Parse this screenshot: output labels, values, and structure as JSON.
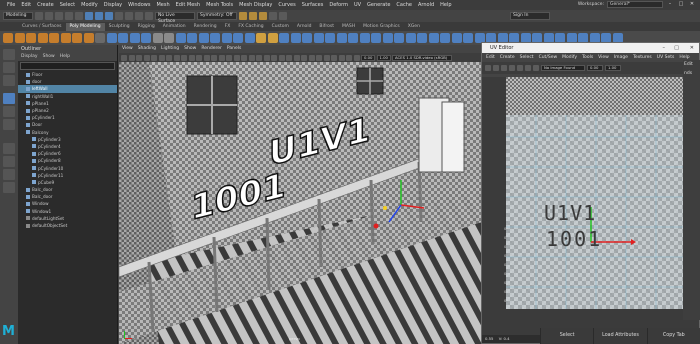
{
  "menubar": {
    "items": [
      "File",
      "Edit",
      "Create",
      "Select",
      "Modify",
      "Display",
      "Windows",
      "Mesh",
      "Edit Mesh",
      "Mesh Tools",
      "Mesh Display",
      "Curves",
      "Surfaces",
      "Deform",
      "UV",
      "Generate",
      "Cache",
      "Arnold",
      "Help"
    ],
    "workspace_label": "Workspace:",
    "workspace_value": "General*"
  },
  "statusline": {
    "mode": "Modeling",
    "no_live_surface": "No Live Surface",
    "symmetry": "Symmetry: Off",
    "sign_in": "Sign In"
  },
  "shelf": {
    "tabs": [
      "Curves / Surfaces",
      "Poly Modeling",
      "Sculpting",
      "Rigging",
      "Animation",
      "Rendering",
      "FX",
      "FX Caching",
      "Custom",
      "Arnold",
      "Bifrost",
      "MASH",
      "Motion Graphics",
      "XGen"
    ],
    "active_tab": "Poly Modeling"
  },
  "outliner": {
    "title": "Outliner",
    "menu": [
      "Display",
      "Show",
      "Help"
    ],
    "items": [
      {
        "label": "Floor",
        "selected": false
      },
      {
        "label": "door",
        "selected": false
      },
      {
        "label": "leftWall",
        "selected": true
      },
      {
        "label": "rightWall1",
        "selected": false
      },
      {
        "label": "pPlane1",
        "selected": false
      },
      {
        "label": "pPlane2",
        "selected": false
      },
      {
        "label": "pCylinder1",
        "selected": false
      },
      {
        "label": "Door",
        "selected": false
      },
      {
        "label": "Balcony",
        "selected": false
      },
      {
        "label": "pCylinder3",
        "selected": false
      },
      {
        "label": "pCylinder4",
        "selected": false
      },
      {
        "label": "pCylinder6",
        "selected": false
      },
      {
        "label": "pCylinder8",
        "selected": false
      },
      {
        "label": "pCylinder10",
        "selected": false
      },
      {
        "label": "pCylinder11",
        "selected": false
      },
      {
        "label": "pCube9",
        "selected": false
      },
      {
        "label": "Balc_door",
        "selected": false
      },
      {
        "label": "Balc_door",
        "selected": false
      },
      {
        "label": "Window",
        "selected": false
      },
      {
        "label": "Window1",
        "selected": false
      },
      {
        "label": "defaultLightSet",
        "selected": false
      },
      {
        "label": "defaultObjectSet",
        "selected": false
      }
    ]
  },
  "viewport": {
    "menu": [
      "View",
      "Shading",
      "Lighting",
      "Show",
      "Renderer",
      "Panels"
    ],
    "values": [
      "0.00",
      "1.00"
    ],
    "colorspace": "ACES 1.0 SDR-video (sRGB)",
    "camera_label": "persp",
    "text_top": "U1V1",
    "text_bottom": "1001"
  },
  "uv_editor": {
    "title": "UV Editor",
    "menu": [
      "Edit",
      "Create",
      "Select",
      "Cut/Sew",
      "Modify",
      "Tools",
      "View",
      "Image",
      "Textures",
      "UV Sets",
      "Help"
    ],
    "no_image": "No Image Found",
    "uv_label_top": "U1V1",
    "uv_label_bottom": "1001",
    "status": "(19/1) UV shells, 0(0/0) overlapping UVs, 0(0/0) reversed UVs",
    "zoom_value": "0.55",
    "v_label": "V:",
    "v_value": "0.4",
    "ticks": [
      "0.9",
      "0.8",
      "0.7",
      "0.6",
      "0.5",
      "0.4",
      "0.3",
      "0.2",
      "0.1"
    ]
  },
  "attribute_bar": {
    "buttons": [
      "Select",
      "Load Attributes",
      "Copy Tab"
    ]
  },
  "right_panel": {
    "labels": [
      "Edit",
      "nds"
    ]
  },
  "colors": {
    "accent": "#4f80c0",
    "selection": "#5285a6",
    "uv_mesh": "#5fbfe5"
  }
}
